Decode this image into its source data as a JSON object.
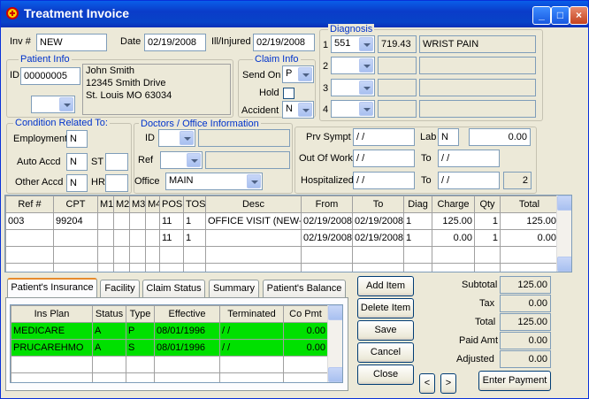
{
  "window": {
    "title": "Treatment Invoice"
  },
  "header": {
    "inv_label": "Inv #",
    "inv_value": "NEW",
    "date_label": "Date",
    "date_value": "02/19/2008",
    "ill_label": "Ill/Injured",
    "ill_value": "02/19/2008"
  },
  "patient": {
    "group": "Patient Info",
    "id_label": "ID",
    "id_value": "00000005",
    "name": "John Smith",
    "address1": "12345 Smith Drive",
    "address2": "St. Louis MO 63034"
  },
  "claim": {
    "group": "Claim Info",
    "send_on_label": "Send On",
    "send_on_value": "P",
    "hold_label": "Hold",
    "accident_label": "Accident",
    "accident_value": "N"
  },
  "diagnosis": {
    "group": "Diagnosis",
    "rows": [
      {
        "num": "1",
        "code": "551",
        "icd": "719.43",
        "desc": "WRIST PAIN"
      },
      {
        "num": "2",
        "code": "",
        "icd": "",
        "desc": ""
      },
      {
        "num": "3",
        "code": "",
        "icd": "",
        "desc": ""
      },
      {
        "num": "4",
        "code": "",
        "icd": "",
        "desc": ""
      }
    ]
  },
  "condition": {
    "group": "Condition Related To:",
    "employment_label": "Employment",
    "employment_value": "N",
    "auto_label": "Auto Accd",
    "auto_value": "N",
    "st_label": "ST",
    "other_label": "Other Accd",
    "other_value": "N",
    "hr_label": "HR"
  },
  "doctors": {
    "group": "Doctors / Office Information",
    "id_label": "ID",
    "ref_label": "Ref",
    "office_label": "Office",
    "office_value": "MAIN"
  },
  "dates": {
    "prv_label": "Prv Sympt",
    "prv_value": " / /",
    "lab_label": "Lab",
    "lab_value": "N",
    "lab_amount": "0.00",
    "out_label": "Out Of Work",
    "out_value": " / /",
    "to1_label": "To",
    "to1_value": " / /",
    "hosp_label": "Hospitalized",
    "hosp_value": " / /",
    "to2_label": "To",
    "to2_value": " / /",
    "hosp_count": "2"
  },
  "lines": {
    "columns": [
      "Ref #",
      "CPT",
      "M1",
      "M2",
      "M3",
      "M4",
      "POS",
      "TOS",
      "Desc",
      "From",
      "To",
      "Diag",
      "Charge",
      "Qty",
      "Total"
    ],
    "rows": [
      [
        "003",
        "99204",
        "",
        "",
        "",
        "",
        "11",
        "1",
        "OFFICE VISIT (NEW-M",
        "02/19/2008",
        "02/19/2008",
        "1",
        "125.00",
        "1",
        "125.00"
      ],
      [
        "",
        "",
        "",
        "",
        "",
        "",
        "11",
        "1",
        "",
        "02/19/2008",
        "02/19/2008",
        "1",
        "0.00",
        "1",
        "0.00"
      ],
      [
        "",
        "",
        "",
        "",
        "",
        "",
        "",
        "",
        "",
        "",
        "",
        "",
        "",
        "",
        ""
      ],
      [
        "",
        "",
        "",
        "",
        "",
        "",
        "",
        "",
        "",
        "",
        "",
        "",
        "",
        "",
        ""
      ]
    ]
  },
  "tabs": [
    "Patient's Insurance",
    "Facility",
    "Claim Status",
    "Summary",
    "Patient's Balance"
  ],
  "insurance": {
    "columns": [
      "Ins Plan",
      "Status",
      "Type",
      "Effective",
      "Terminated",
      "Co Pmt"
    ],
    "rows": [
      [
        "MEDICARE",
        "A",
        "P",
        "08/01/1996",
        " / /",
        "0.00"
      ],
      [
        "PRUCAREHMO",
        "A",
        "S",
        "08/01/1996",
        " / /",
        "0.00"
      ],
      [
        "",
        "",
        "",
        "",
        "",
        ""
      ],
      [
        "",
        "",
        "",
        "",
        "",
        ""
      ],
      [
        "",
        "",
        "",
        "",
        "",
        ""
      ]
    ]
  },
  "actions": {
    "add": "Add Item",
    "delete": "Delete Item",
    "save": "Save",
    "cancel": "Cancel",
    "close": "Close",
    "prev": "<",
    "next": ">",
    "enter_payment": "Enter Payment"
  },
  "totals": {
    "subtotal_label": "Subtotal",
    "subtotal": "125.00",
    "tax_label": "Tax",
    "tax": "0.00",
    "total_label": "Total",
    "total": "125.00",
    "paid_label": "Paid Amt",
    "paid": "0.00",
    "adjusted_label": "Adjusted",
    "adjusted": "0.00"
  }
}
